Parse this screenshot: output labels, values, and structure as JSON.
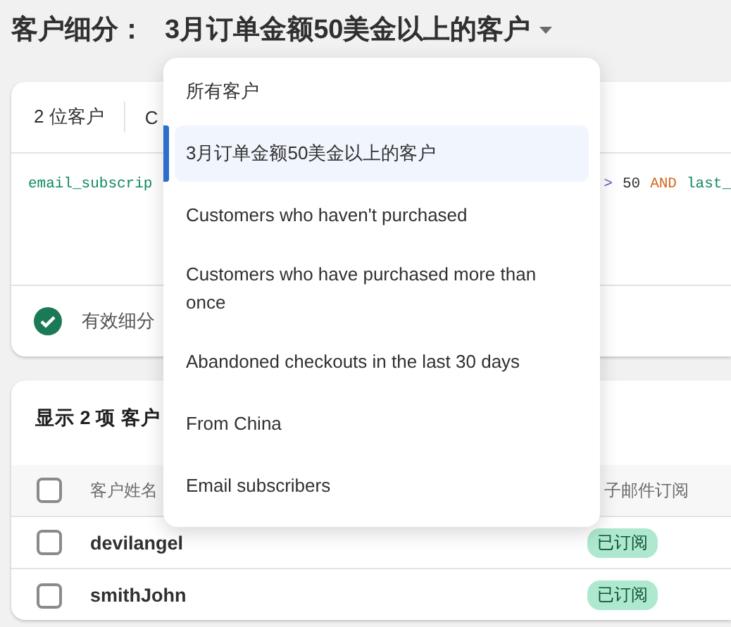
{
  "header": {
    "label": "客户细分：",
    "segment": "3月订单金额50美金以上的客户"
  },
  "summary": {
    "count": "2 位客户",
    "column_2": "C"
  },
  "query": {
    "left": [
      {
        "kind": "field",
        "text": "email_subscrip"
      }
    ],
    "right": [
      {
        "kind": "operator",
        "text": ">"
      },
      {
        "kind": "number",
        "text": "50"
      },
      {
        "kind": "keyword",
        "text": "AND"
      },
      {
        "kind": "field",
        "text": "last_"
      }
    ]
  },
  "status": {
    "text": "有效细分"
  },
  "results": {
    "title": "显示 2 项 客户",
    "select_all": {
      "checked": false
    },
    "columns": [
      "客户姓名",
      "子邮件订阅"
    ],
    "rows": [
      {
        "name": "devilangel",
        "subscription": "已订阅",
        "checked": false
      },
      {
        "name": "smithJohn",
        "subscription": "已订阅",
        "checked": false
      }
    ]
  },
  "dropdown": {
    "items": [
      {
        "label": "所有客户",
        "selected": false
      },
      {
        "label": "3月订单金额50美金以上的客户",
        "selected": true
      },
      {
        "label": "Customers who haven't purchased",
        "selected": false
      },
      {
        "label": "Customers who have purchased more than once",
        "selected": false
      },
      {
        "label": "Abandoned checkouts in the last 30 days",
        "selected": false
      },
      {
        "label": "From China",
        "selected": false
      },
      {
        "label": "Email subscribers",
        "selected": false
      }
    ]
  }
}
